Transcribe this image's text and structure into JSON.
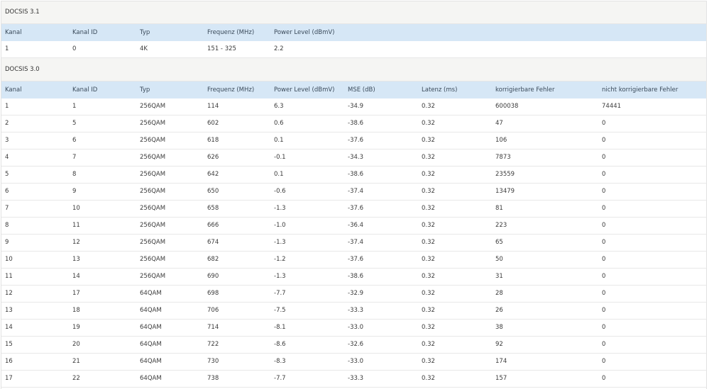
{
  "docsis31": {
    "title": "DOCSIS 3.1",
    "headers": {
      "kanal": "Kanal",
      "kanal_id": "Kanal ID",
      "typ": "Typ",
      "frequenz": "Frequenz (MHz)",
      "power": "Power Level (dBmV)"
    },
    "rows": [
      {
        "kanal": "1",
        "kanal_id": "0",
        "typ": "4K",
        "frequenz": "151 - 325",
        "power": "2.2"
      }
    ]
  },
  "docsis30": {
    "title": "DOCSIS 3.0",
    "headers": {
      "kanal": "Kanal",
      "kanal_id": "Kanal ID",
      "typ": "Typ",
      "frequenz": "Frequenz (MHz)",
      "power": "Power Level (dBmV)",
      "mse": "MSE (dB)",
      "latenz": "Latenz (ms)",
      "korr": "korrigierbare Fehler",
      "nicht_korr": "nicht korrigierbare Fehler"
    },
    "rows": [
      {
        "kanal": "1",
        "kanal_id": "1",
        "typ": "256QAM",
        "frequenz": "114",
        "power": "6.3",
        "mse": "-34.9",
        "latenz": "0.32",
        "korr": "600038",
        "nicht_korr": "74441"
      },
      {
        "kanal": "2",
        "kanal_id": "5",
        "typ": "256QAM",
        "frequenz": "602",
        "power": "0.6",
        "mse": "-38.6",
        "latenz": "0.32",
        "korr": "47",
        "nicht_korr": "0"
      },
      {
        "kanal": "3",
        "kanal_id": "6",
        "typ": "256QAM",
        "frequenz": "618",
        "power": "0.1",
        "mse": "-37.6",
        "latenz": "0.32",
        "korr": "106",
        "nicht_korr": "0"
      },
      {
        "kanal": "4",
        "kanal_id": "7",
        "typ": "256QAM",
        "frequenz": "626",
        "power": "-0.1",
        "mse": "-34.3",
        "latenz": "0.32",
        "korr": "7873",
        "nicht_korr": "0"
      },
      {
        "kanal": "5",
        "kanal_id": "8",
        "typ": "256QAM",
        "frequenz": "642",
        "power": "0.1",
        "mse": "-38.6",
        "latenz": "0.32",
        "korr": "23559",
        "nicht_korr": "0"
      },
      {
        "kanal": "6",
        "kanal_id": "9",
        "typ": "256QAM",
        "frequenz": "650",
        "power": "-0.6",
        "mse": "-37.4",
        "latenz": "0.32",
        "korr": "13479",
        "nicht_korr": "0"
      },
      {
        "kanal": "7",
        "kanal_id": "10",
        "typ": "256QAM",
        "frequenz": "658",
        "power": "-1.3",
        "mse": "-37.6",
        "latenz": "0.32",
        "korr": "81",
        "nicht_korr": "0"
      },
      {
        "kanal": "8",
        "kanal_id": "11",
        "typ": "256QAM",
        "frequenz": "666",
        "power": "-1.0",
        "mse": "-36.4",
        "latenz": "0.32",
        "korr": "223",
        "nicht_korr": "0"
      },
      {
        "kanal": "9",
        "kanal_id": "12",
        "typ": "256QAM",
        "frequenz": "674",
        "power": "-1.3",
        "mse": "-37.4",
        "latenz": "0.32",
        "korr": "65",
        "nicht_korr": "0"
      },
      {
        "kanal": "10",
        "kanal_id": "13",
        "typ": "256QAM",
        "frequenz": "682",
        "power": "-1.2",
        "mse": "-37.6",
        "latenz": "0.32",
        "korr": "50",
        "nicht_korr": "0"
      },
      {
        "kanal": "11",
        "kanal_id": "14",
        "typ": "256QAM",
        "frequenz": "690",
        "power": "-1.3",
        "mse": "-38.6",
        "latenz": "0.32",
        "korr": "31",
        "nicht_korr": "0"
      },
      {
        "kanal": "12",
        "kanal_id": "17",
        "typ": "64QAM",
        "frequenz": "698",
        "power": "-7.7",
        "mse": "-32.9",
        "latenz": "0.32",
        "korr": "28",
        "nicht_korr": "0"
      },
      {
        "kanal": "13",
        "kanal_id": "18",
        "typ": "64QAM",
        "frequenz": "706",
        "power": "-7.5",
        "mse": "-33.3",
        "latenz": "0.32",
        "korr": "26",
        "nicht_korr": "0"
      },
      {
        "kanal": "14",
        "kanal_id": "19",
        "typ": "64QAM",
        "frequenz": "714",
        "power": "-8.1",
        "mse": "-33.0",
        "latenz": "0.32",
        "korr": "38",
        "nicht_korr": "0"
      },
      {
        "kanal": "15",
        "kanal_id": "20",
        "typ": "64QAM",
        "frequenz": "722",
        "power": "-8.6",
        "mse": "-32.6",
        "latenz": "0.32",
        "korr": "92",
        "nicht_korr": "0"
      },
      {
        "kanal": "16",
        "kanal_id": "21",
        "typ": "64QAM",
        "frequenz": "730",
        "power": "-8.3",
        "mse": "-33.0",
        "latenz": "0.32",
        "korr": "174",
        "nicht_korr": "0"
      },
      {
        "kanal": "17",
        "kanal_id": "22",
        "typ": "64QAM",
        "frequenz": "738",
        "power": "-7.7",
        "mse": "-33.3",
        "latenz": "0.32",
        "korr": "157",
        "nicht_korr": "0"
      }
    ]
  }
}
